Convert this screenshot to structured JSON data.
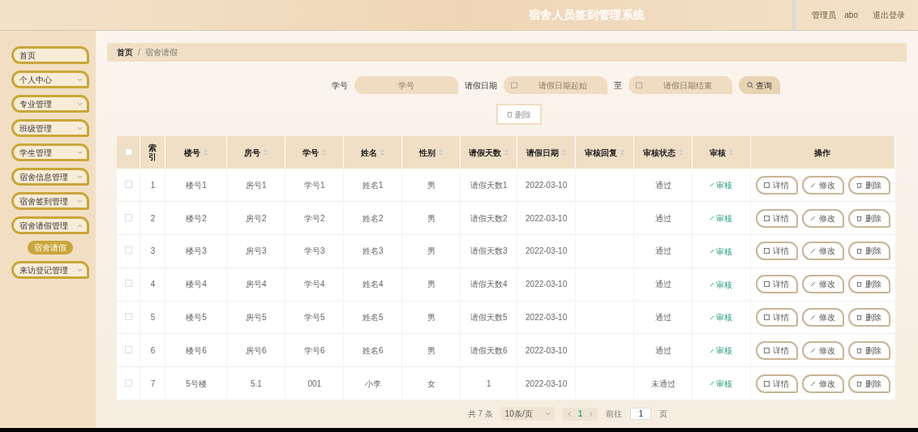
{
  "header": {
    "title": "宿舍人员签到管理系统",
    "user_role": "管理员",
    "user_name": "abo",
    "logout": "退出登录"
  },
  "sidebar": {
    "items": [
      {
        "label": "首页",
        "kind": "link"
      },
      {
        "label": "个人中心",
        "kind": "menu",
        "expanded": false
      },
      {
        "label": "专业管理",
        "kind": "menu",
        "expanded": false
      },
      {
        "label": "班级管理",
        "kind": "menu",
        "expanded": false
      },
      {
        "label": "学生管理",
        "kind": "menu",
        "expanded": false
      },
      {
        "label": "宿舍信息管理",
        "kind": "menu",
        "expanded": false
      },
      {
        "label": "宿舍签到管理",
        "kind": "menu",
        "expanded": false
      },
      {
        "label": "宿舍请假管理",
        "kind": "menu",
        "expanded": true,
        "children": [
          {
            "label": "宿舍请假",
            "selected": true
          }
        ]
      },
      {
        "label": "来访登记管理",
        "kind": "menu",
        "expanded": false
      }
    ]
  },
  "breadcrumb": {
    "separator": "/",
    "items": [
      "首页",
      "宿舍请假"
    ]
  },
  "search": {
    "fields": [
      {
        "label": "学号",
        "placeholder": "学号",
        "kind": "text"
      },
      {
        "label": "请假日期",
        "placeholder": "请假日期起始",
        "kind": "date"
      },
      {
        "label": "至",
        "placeholder": "请假日期结束",
        "kind": "date"
      }
    ],
    "search_button": "查询",
    "delete_button": "删除"
  },
  "table": {
    "columns": [
      {
        "label": "索引",
        "sortable": false
      },
      {
        "label": "楼号",
        "sortable": true
      },
      {
        "label": "房号",
        "sortable": true
      },
      {
        "label": "学号",
        "sortable": true
      },
      {
        "label": "姓名",
        "sortable": true
      },
      {
        "label": "性别",
        "sortable": true
      },
      {
        "label": "请假天数",
        "sortable": true
      },
      {
        "label": "请假日期",
        "sortable": true
      },
      {
        "label": "审核回复",
        "sortable": true
      },
      {
        "label": "审核状态",
        "sortable": true
      },
      {
        "label": "审核",
        "sortable": true
      },
      {
        "label": "操作",
        "sortable": false
      }
    ],
    "all_checked": false,
    "rows": [
      {
        "checked": false,
        "cells": [
          "1",
          "楼号1",
          "房号1",
          "学号1",
          "姓名1",
          "男",
          "请假天数1",
          "2022-03-10",
          "",
          "通过"
        ],
        "review": "审核",
        "actions": [
          "详情",
          "修改",
          "删除"
        ]
      },
      {
        "checked": false,
        "cells": [
          "2",
          "楼号2",
          "房号2",
          "学号2",
          "姓名2",
          "男",
          "请假天数2",
          "2022-03-10",
          "",
          "通过"
        ],
        "review": "审核",
        "actions": [
          "详情",
          "修改",
          "删除"
        ]
      },
      {
        "checked": false,
        "cells": [
          "3",
          "楼号3",
          "房号3",
          "学号3",
          "姓名3",
          "男",
          "请假天数3",
          "2022-03-10",
          "",
          "通过"
        ],
        "review": "审核",
        "actions": [
          "详情",
          "修改",
          "删除"
        ]
      },
      {
        "checked": false,
        "cells": [
          "4",
          "楼号4",
          "房号4",
          "学号4",
          "姓名4",
          "男",
          "请假天数4",
          "2022-03-10",
          "",
          "通过"
        ],
        "review": "审核",
        "actions": [
          "详情",
          "修改",
          "删除"
        ]
      },
      {
        "checked": false,
        "cells": [
          "5",
          "楼号5",
          "房号5",
          "学号5",
          "姓名5",
          "男",
          "请假天数5",
          "2022-03-10",
          "",
          "通过"
        ],
        "review": "审核",
        "actions": [
          "详情",
          "修改",
          "删除"
        ]
      },
      {
        "checked": false,
        "cells": [
          "6",
          "楼号6",
          "房号6",
          "学号6",
          "姓名6",
          "男",
          "请假天数6",
          "2022-03-10",
          "",
          "通过"
        ],
        "review": "审核",
        "actions": [
          "详情",
          "修改",
          "删除"
        ]
      },
      {
        "checked": false,
        "cells": [
          "7",
          "5号楼",
          "5.1",
          "001",
          "小李",
          "女",
          "1",
          "2022-03-10",
          "",
          "未通过"
        ],
        "review": "审核",
        "actions": [
          "详情",
          "修改",
          "删除"
        ]
      }
    ]
  },
  "pagination": {
    "total": "共 7 条",
    "page_size": "10条/页",
    "pages": [
      {
        "label": "1",
        "selected": true
      }
    ],
    "goto_label": "前往",
    "goto_value": "1",
    "goto_suffix": "页"
  }
}
